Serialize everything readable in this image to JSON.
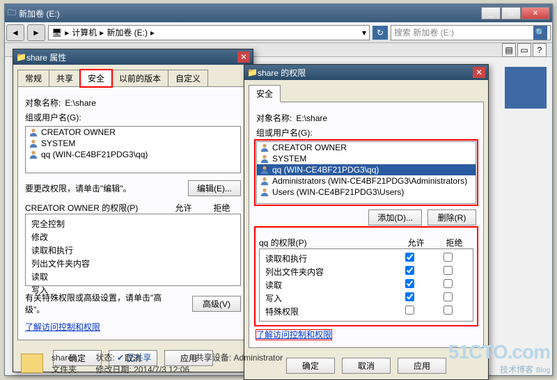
{
  "explorer": {
    "title": "新加卷 (E:)",
    "breadcrumb": [
      "计算机",
      "新加卷 (E:)"
    ],
    "search_placeholder": "搜索 新加卷 (E:)"
  },
  "propDlg": {
    "title": "share 属性",
    "tabs": [
      "常规",
      "共享",
      "安全",
      "以前的版本",
      "自定义"
    ],
    "active_tab": 2,
    "object_label": "对象名称:",
    "object_value": "E:\\share",
    "group_label": "组或用户名(G):",
    "users": [
      "CREATOR OWNER",
      "SYSTEM",
      "qq (WIN-CE4BF21PDG3\\qq)"
    ],
    "edit_hint": "要更改权限，请单击\"编辑\"。",
    "edit_btn": "编辑(E)...",
    "perm_label": "CREATOR OWNER 的权限(P)",
    "allow": "允许",
    "deny": "拒绝",
    "perms": [
      "完全控制",
      "修改",
      "读取和执行",
      "列出文件夹内容",
      "读取",
      "写入"
    ],
    "adv_hint": "有关特殊权限或高级设置，请单击\"高级\"。",
    "adv_btn": "高级(V)",
    "link": "了解访问控制和权限",
    "ok": "确定",
    "cancel": "取消",
    "apply": "应用"
  },
  "permDlg": {
    "title": "share 的权限",
    "tab": "安全",
    "object_label": "对象名称:",
    "object_value": "E:\\share",
    "group_label": "组或用户名(G):",
    "users": [
      {
        "name": "CREATOR OWNER",
        "sel": false
      },
      {
        "name": "SYSTEM",
        "sel": false
      },
      {
        "name": "qq (WIN-CE4BF21PDG3\\qq)",
        "sel": true
      },
      {
        "name": "Administrators (WIN-CE4BF21PDG3\\Administrators)",
        "sel": false
      },
      {
        "name": "Users (WIN-CE4BF21PDG3\\Users)",
        "sel": false
      }
    ],
    "add_btn": "添加(D)...",
    "remove_btn": "删除(R)",
    "perm_label": "qq 的权限(P)",
    "allow": "允许",
    "deny": "拒绝",
    "perms": [
      {
        "name": "读取和执行",
        "allow": true,
        "deny": false
      },
      {
        "name": "列出文件夹内容",
        "allow": true,
        "deny": false
      },
      {
        "name": "读取",
        "allow": true,
        "deny": false
      },
      {
        "name": "写入",
        "allow": true,
        "deny": false
      },
      {
        "name": "特殊权限",
        "allow": false,
        "deny": false
      }
    ],
    "link": "了解访问控制和权限",
    "ok": "确定",
    "cancel": "取消",
    "apply": "应用"
  },
  "footer": {
    "name": "share",
    "state_lbl": "状态:",
    "state_val": "已共享",
    "share_lbl": "共享设备:",
    "share_val": "Administrator",
    "type_lbl": "文件夹",
    "mod_lbl": "修改日期:",
    "mod_val": "2014/7/3 12:06"
  },
  "watermark": {
    "brand": "51CTO.com",
    "sub": "技术博客",
    "tag": "Blog"
  }
}
